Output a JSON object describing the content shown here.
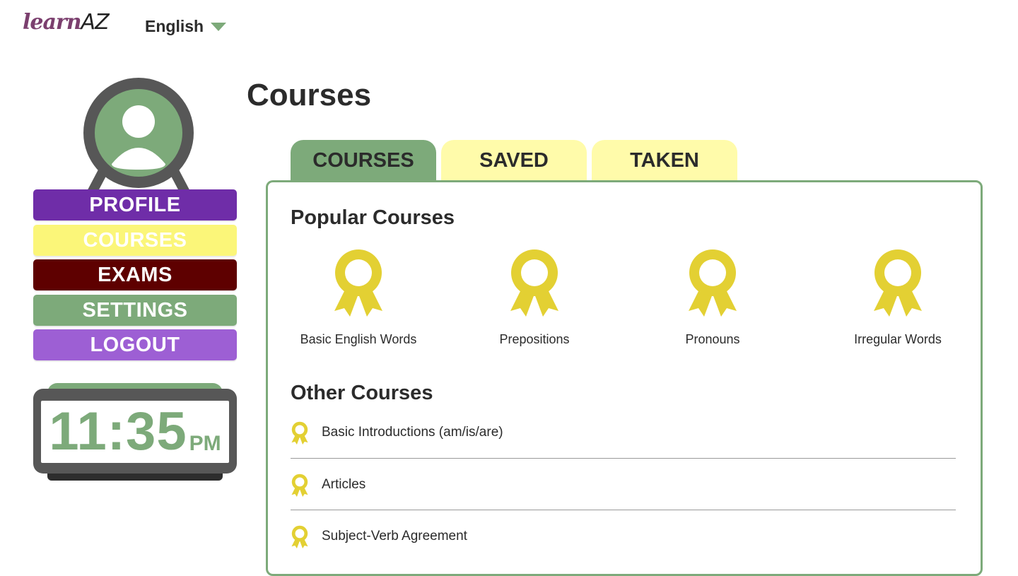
{
  "header": {
    "logo_learn": "learn",
    "logo_az": "AZ",
    "language": "English"
  },
  "sidebar": {
    "menu": [
      {
        "label": "PROFILE"
      },
      {
        "label": "COURSES"
      },
      {
        "label": "EXAMS"
      },
      {
        "label": "SETTINGS"
      },
      {
        "label": "LOGOUT"
      }
    ],
    "clock": {
      "time": "11:35",
      "ampm": "PM"
    }
  },
  "main": {
    "title": "Courses",
    "tabs": [
      {
        "label": "COURSES"
      },
      {
        "label": "SAVED"
      },
      {
        "label": "TAKEN"
      }
    ],
    "popular_title": "Popular Courses",
    "popular_courses": [
      {
        "label": "Basic English Words",
        "icon": "award-ribbon-icon"
      },
      {
        "label": "Prepositions",
        "icon": "award-ribbon-icon"
      },
      {
        "label": "Pronouns",
        "icon": "award-ribbon-icon"
      },
      {
        "label": "Irregular Words",
        "icon": "award-ribbon-icon"
      }
    ],
    "other_title": "Other Courses",
    "other_courses": [
      {
        "label": "Basic Introductions (am/is/are)",
        "icon": "award-ribbon-icon"
      },
      {
        "label": "Articles",
        "icon": "award-ribbon-icon"
      },
      {
        "label": "Subject-Verb Agreement",
        "icon": "award-ribbon-icon"
      }
    ]
  },
  "colors": {
    "accent_green": "#7daa7a",
    "badge_yellow": "#e3d033",
    "tab_yellow": "#fffbaa",
    "profile_purple": "#6f2da8",
    "exams_maroon": "#5e0000",
    "logout_purple": "#9d5fd4"
  }
}
